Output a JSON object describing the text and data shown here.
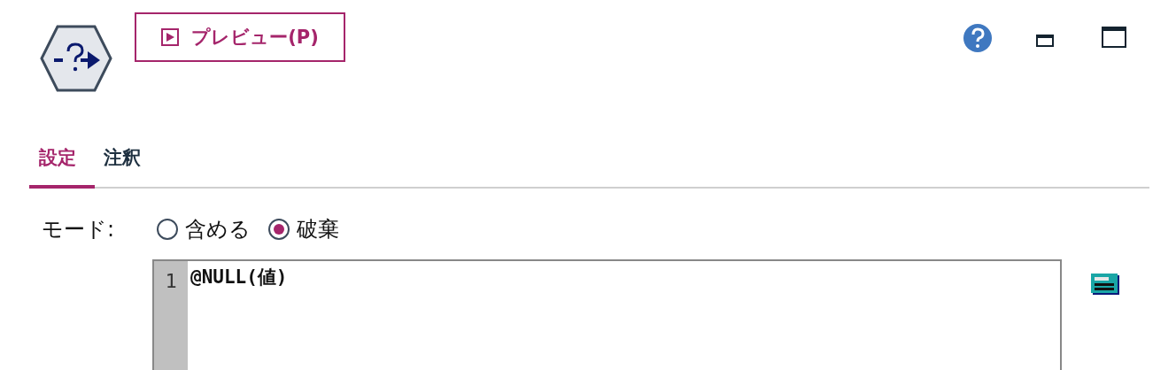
{
  "toolbar": {
    "preview_button": "プレビュー(P)"
  },
  "tabs": [
    {
      "label": "設定",
      "selected": true
    },
    {
      "label": "注釈",
      "selected": false
    }
  ],
  "mode": {
    "label": "モード:",
    "options": [
      {
        "label": "含める",
        "selected": false
      },
      {
        "label": "破棄",
        "selected": true
      }
    ]
  },
  "editor": {
    "lines": [
      {
        "number": "1",
        "text": "@NULL(値)"
      }
    ]
  }
}
